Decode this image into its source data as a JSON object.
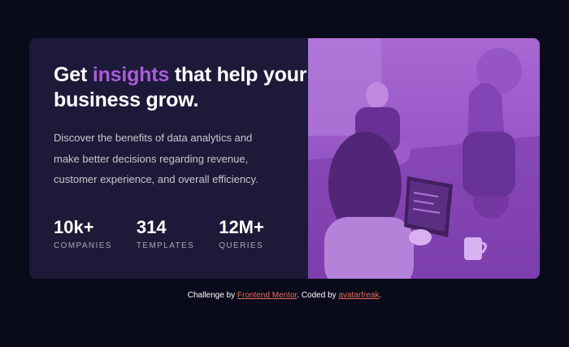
{
  "card": {
    "headline_before": "Get ",
    "headline_accent": "insights",
    "headline_after": " that help your business grow.",
    "description": "Discover the benefits of data analytics and make better decisions regarding revenue, customer experience, and overall efficiency.",
    "stats": [
      {
        "value": "10k+",
        "label": "COMPANIES"
      },
      {
        "value": "314",
        "label": "TEMPLATES"
      },
      {
        "value": "12M+",
        "label": "QUERIES"
      }
    ],
    "image_alt": "Office workers collaborating around a table"
  },
  "attribution": {
    "prefix": "Challenge by ",
    "mentor_link": "Frontend Mentor",
    "middle": ". Coded by ",
    "author_link": "avatarfreak",
    "suffix": "."
  },
  "colors": {
    "background": "#090b1a",
    "card": "#1c1a38",
    "accent": "#aa5cdb",
    "image_overlay": "#8a4ab8",
    "link": "#e86b5a"
  }
}
